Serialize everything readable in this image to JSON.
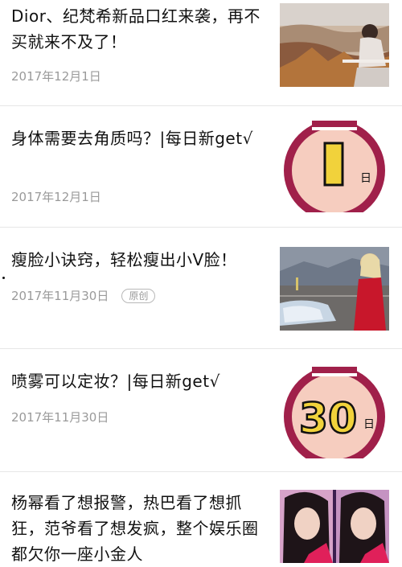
{
  "articles": [
    {
      "title": "Dior、纪梵希新品口红来袭，再不买就来不及了！",
      "date": "2017年12月1日",
      "thumbnail": "photo-woman-overlooking-city"
    },
    {
      "title": "身体需要去角质吗？|每日新get√",
      "date": "2017年12月1日",
      "thumbnail": "daily-new-get-badge",
      "badge_number": "1",
      "badge_unit": "日"
    },
    {
      "title": "瘦脸小诀窍，轻松瘦出小V脸！",
      "date": "2017年11月30日",
      "tag": "原创",
      "thumbnail": "photo-woman-red-dress-car"
    },
    {
      "title": "喷雾可以定妆？|每日新get√",
      "date": "2017年11月30日",
      "thumbnail": "daily-new-get-badge",
      "badge_number": "30",
      "badge_unit": "日"
    },
    {
      "title": "杨幂看了想报警，热巴看了想抓狂，范爷看了想发疯，整个娱乐圈都欠你一座小金人",
      "thumbnail": "photo-two-actress-portraits"
    }
  ],
  "colors": {
    "badge_ring": "#a0204a",
    "badge_fill": "#f6cdbf",
    "badge_number_fill": "#f1d23b",
    "date_text": "#9a9a9a"
  }
}
